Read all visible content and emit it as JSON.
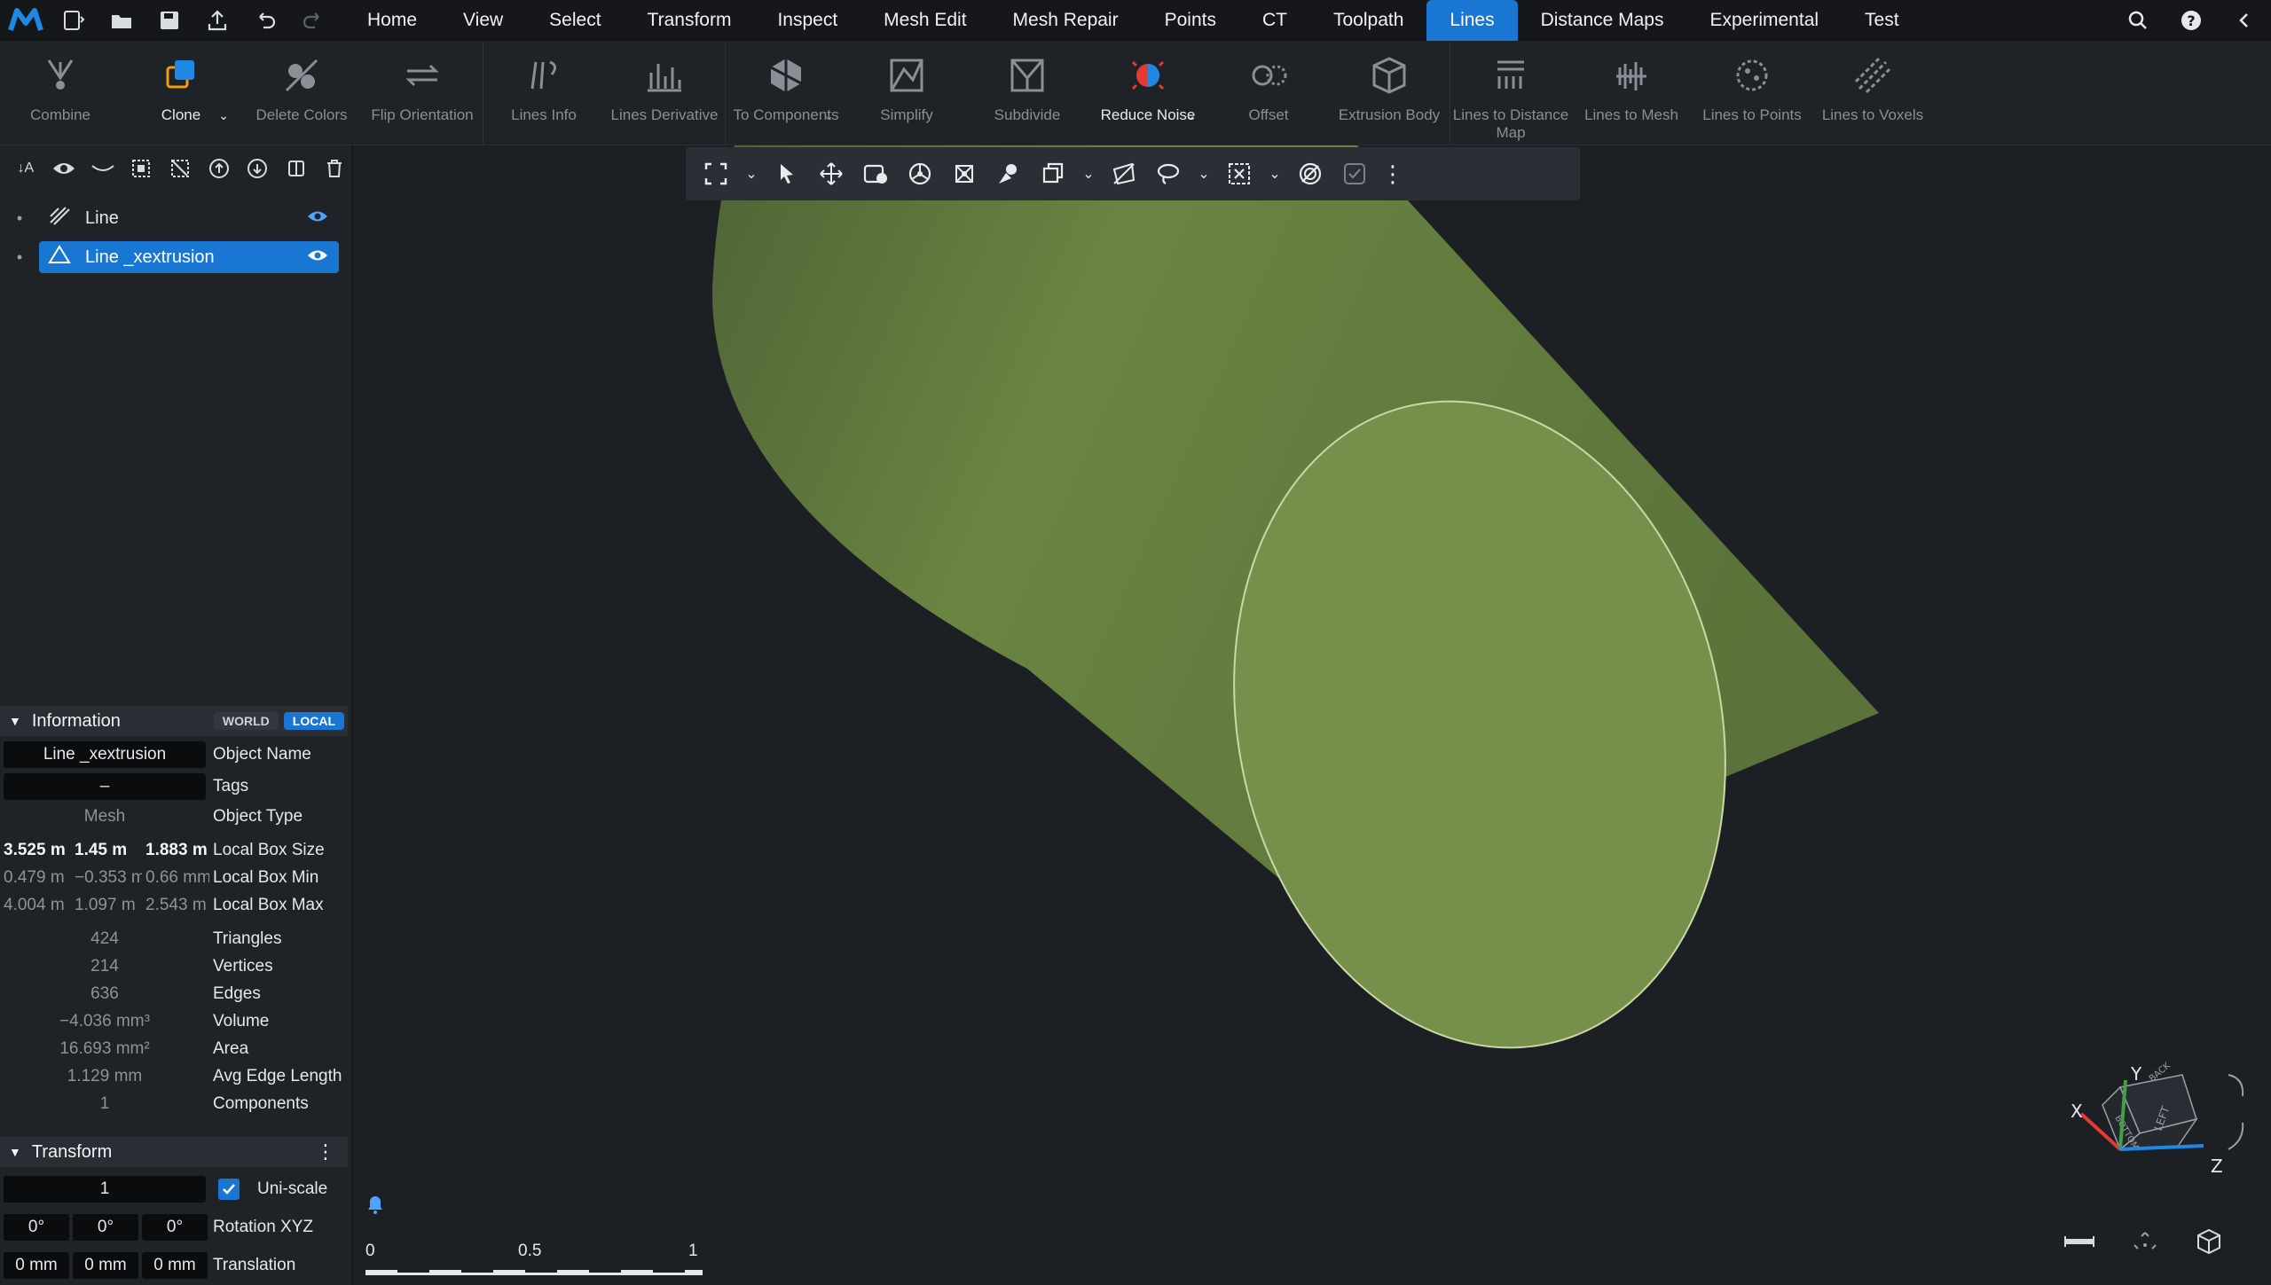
{
  "menu": {
    "tabs": [
      "Home",
      "View",
      "Select",
      "Transform",
      "Inspect",
      "Mesh Edit",
      "Mesh Repair",
      "Points",
      "CT",
      "Toolpath",
      "Lines",
      "Distance Maps",
      "Experimental",
      "Test"
    ],
    "active_tab": "Lines"
  },
  "ribbon": {
    "buttons": [
      {
        "label": "Combine",
        "icon": "combine-icon",
        "enabled": false
      },
      {
        "label": "Clone",
        "icon": "clone-icon",
        "enabled": true,
        "dropdown": true
      },
      {
        "label": "Delete Colors",
        "icon": "delete-colors-icon",
        "enabled": false
      },
      {
        "label": "Flip Orientation",
        "icon": "flip-orientation-icon",
        "enabled": false
      },
      {
        "label": "Lines Info",
        "icon": "lines-info-icon",
        "enabled": false
      },
      {
        "label": "Lines Derivative",
        "icon": "lines-derivative-icon",
        "enabled": false
      },
      {
        "label": "To Components",
        "icon": "to-components-icon",
        "enabled": false,
        "dropdown": true
      },
      {
        "label": "Simplify",
        "icon": "simplify-icon",
        "enabled": false
      },
      {
        "label": "Subdivide",
        "icon": "subdivide-icon",
        "enabled": false
      },
      {
        "label": "Reduce Noise",
        "icon": "reduce-noise-icon",
        "enabled": true,
        "dropdown": true
      },
      {
        "label": "Offset",
        "icon": "offset-icon",
        "enabled": false
      },
      {
        "label": "Extrusion Body",
        "icon": "extrusion-body-icon",
        "enabled": false
      },
      {
        "label": "Lines to Distance Map",
        "icon": "lines-to-distance-map-icon",
        "enabled": false
      },
      {
        "label": "Lines to Mesh",
        "icon": "lines-to-mesh-icon",
        "enabled": false
      },
      {
        "label": "Lines to Points",
        "icon": "lines-to-points-icon",
        "enabled": false
      },
      {
        "label": "Lines to Voxels",
        "icon": "lines-to-voxels-icon",
        "enabled": false
      }
    ]
  },
  "scene": {
    "objects": [
      {
        "name": "Line",
        "icon": "lines-object-icon",
        "selected": false
      },
      {
        "name": "Line _xextrusion",
        "icon": "mesh-object-icon",
        "selected": true
      }
    ]
  },
  "information": {
    "title": "Information",
    "world": "WORLD",
    "local": "LOCAL",
    "object_name": "Line _xextrusion",
    "object_name_label": "Object Name",
    "tags": "–",
    "tags_label": "Tags",
    "object_type": "Mesh",
    "object_type_label": "Object Type",
    "box_size": [
      "3.525 m",
      "1.45 m",
      "1.883 m"
    ],
    "box_size_label": "Local Box Size",
    "box_min": [
      "0.479 m",
      "−0.353 m",
      "0.66 mm"
    ],
    "box_min_label": "Local Box Min",
    "box_max": [
      "4.004 m",
      "1.097 m",
      "2.543 m"
    ],
    "box_max_label": "Local Box Max",
    "triangles": "424",
    "triangles_label": "Triangles",
    "vertices": "214",
    "vertices_label": "Vertices",
    "edges": "636",
    "edges_label": "Edges",
    "volume": "−4.036 mm³",
    "volume_label": "Volume",
    "area": "16.693 mm²",
    "area_label": "Area",
    "avg_edge": "1.129 mm",
    "avg_edge_label": "Avg Edge Length",
    "components": "1",
    "components_label": "Components"
  },
  "transform": {
    "title": "Transform",
    "uniscale_value": "1",
    "uniscale_label": "Uni-scale",
    "rotation": [
      "0°",
      "0°",
      "0°"
    ],
    "rotation_label": "Rotation XYZ",
    "translation": [
      "0 mm",
      "0 mm",
      "0 mm"
    ],
    "translation_label": "Translation"
  },
  "scale_bar": {
    "ticks": [
      "0",
      "0.5",
      "1"
    ]
  },
  "view_cube": {
    "axes": [
      "X",
      "Y",
      "Z"
    ],
    "faces": [
      "BACK",
      "BOTTOM",
      "LEFT"
    ]
  },
  "colors": {
    "accent": "#1976d2",
    "mesh": "#6f8a45",
    "mesh_cap": "#7a9650",
    "bg": "#1c1f24"
  }
}
